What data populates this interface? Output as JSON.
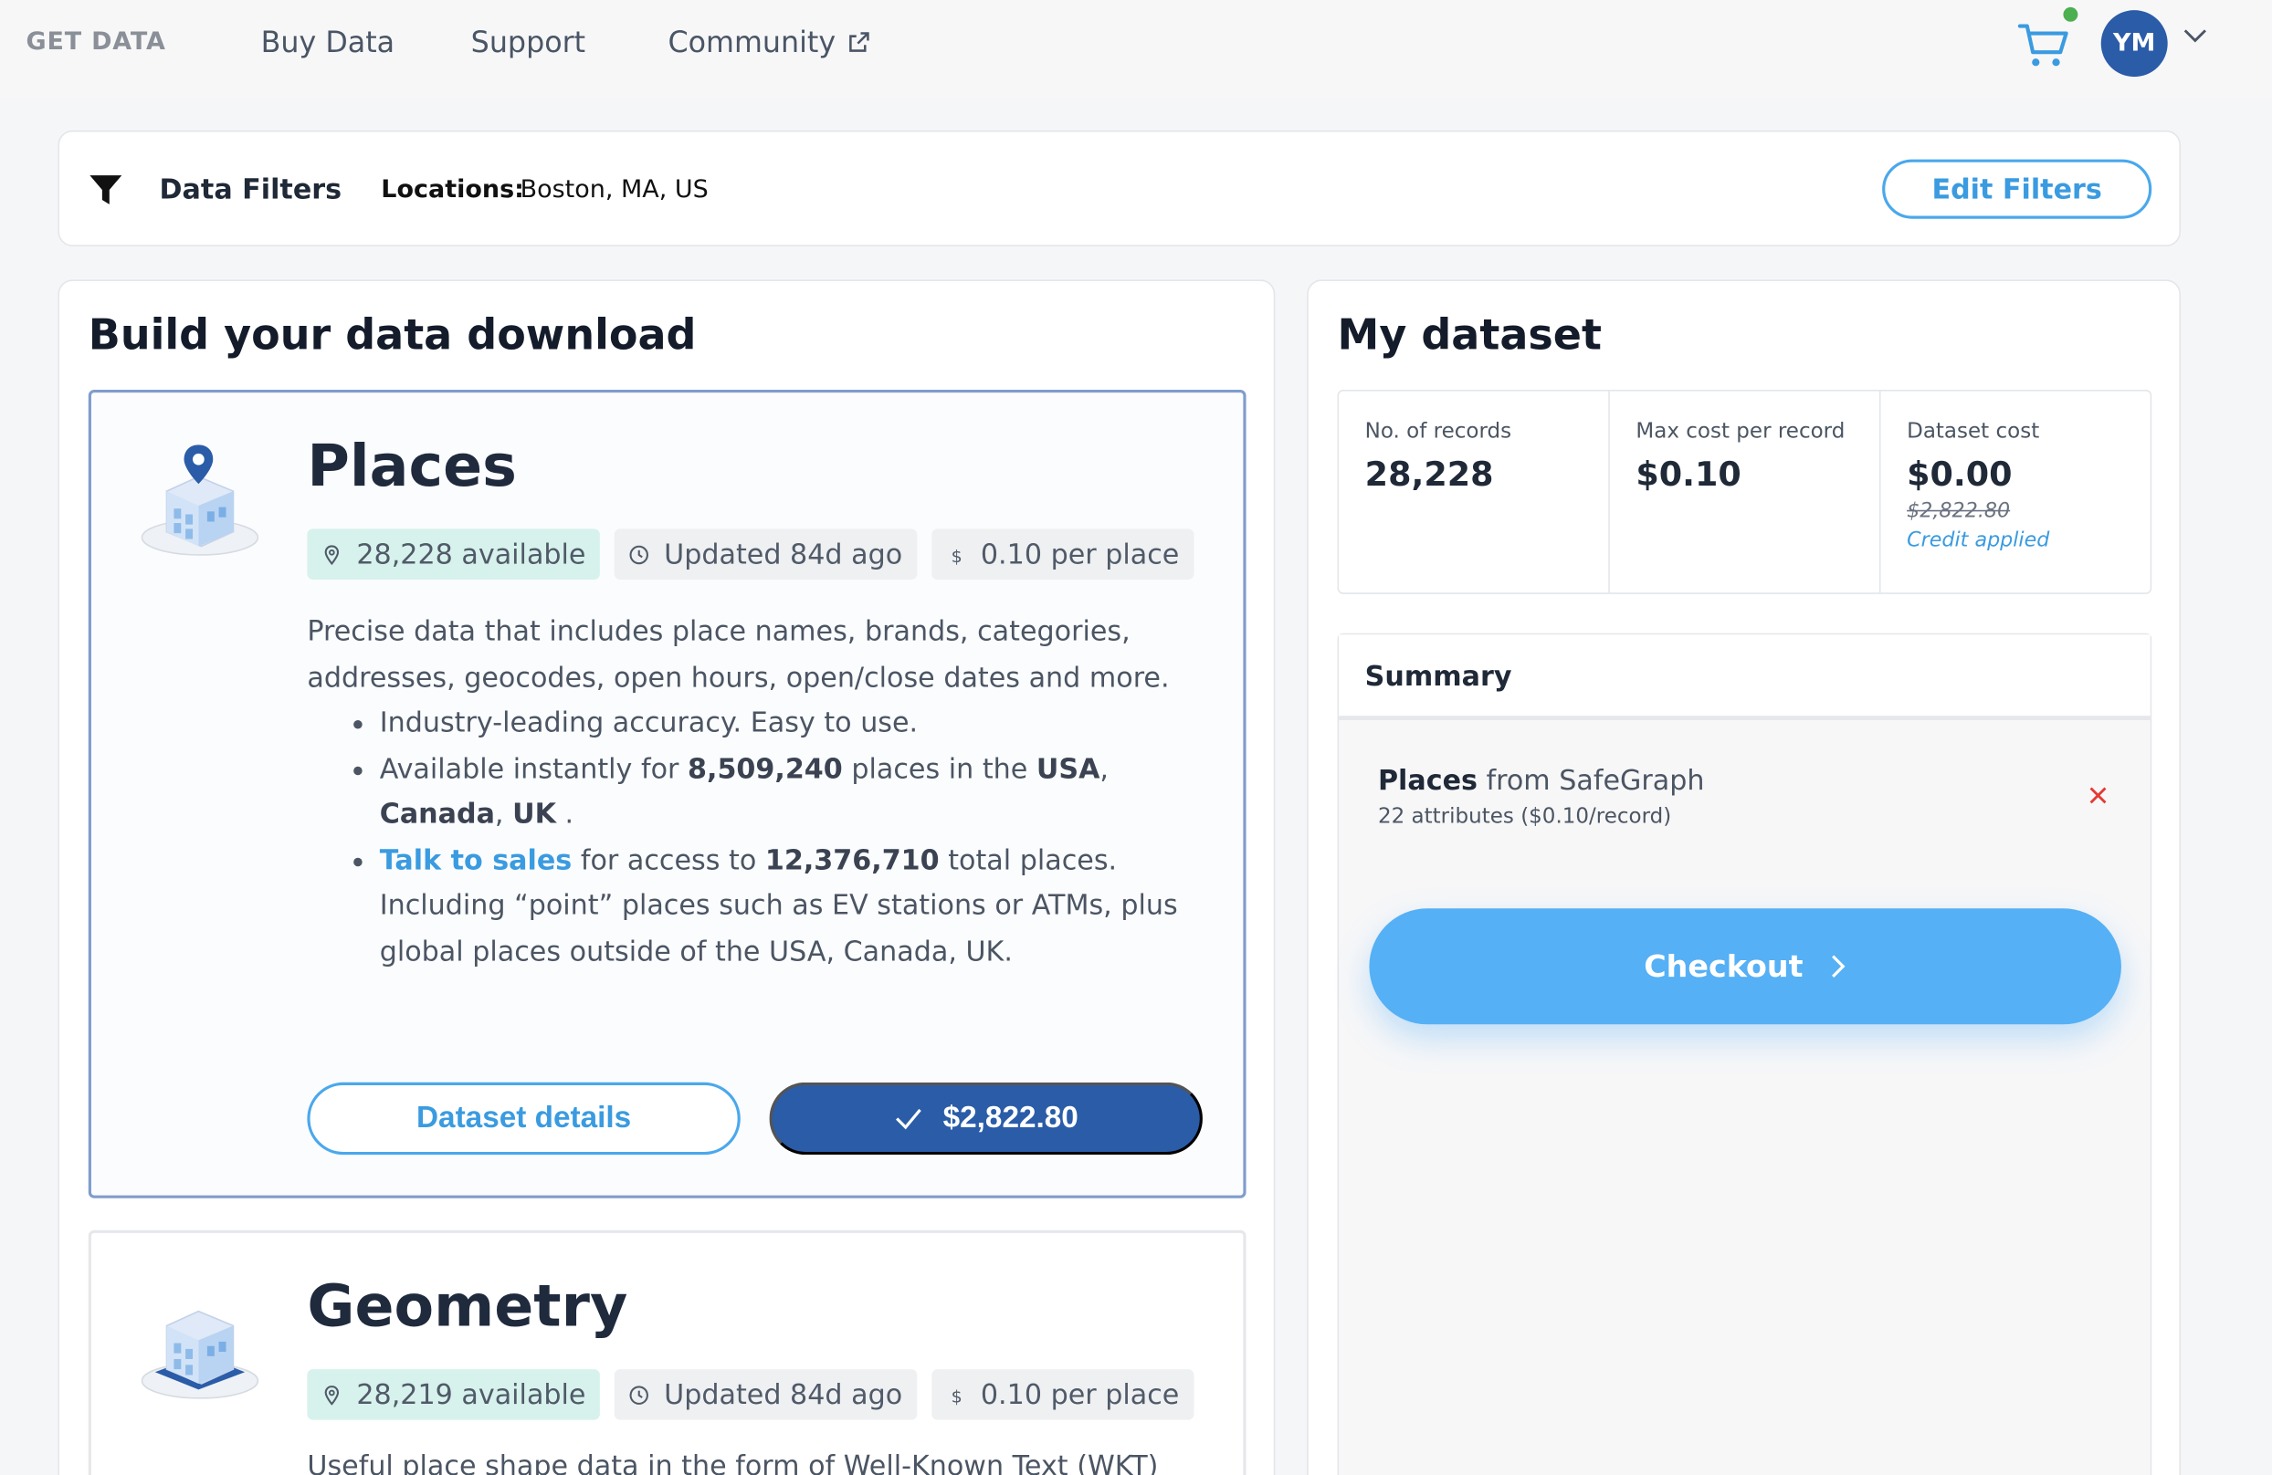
{
  "nav": {
    "brand": "GET DATA",
    "links": [
      "Buy Data",
      "Support",
      "Community"
    ],
    "avatar_initials": "YM",
    "notification_color": "#4caf50"
  },
  "filters": {
    "title": "Data Filters",
    "locations_label": "Locations:",
    "locations_value": "Boston, MA, US",
    "edit_label": "Edit Filters"
  },
  "build": {
    "title": "Build your data download",
    "places": {
      "title": "Places",
      "available": "28,228 available",
      "updated": "Updated 84d ago",
      "price": "0.10 per place",
      "description": "Precise data that includes place names, brands, categories, addresses, geocodes, open hours, open/close dates and more.",
      "bullet1": "Industry-leading accuracy. Easy to use.",
      "bullet2_pre": "Available instantly for ",
      "bullet2_count": "8,509,240",
      "bullet2_mid": " places in the ",
      "bullet2_usa": "USA",
      "bullet2_canada": "Canada",
      "bullet2_uk": "UK",
      "bullet3_link": "Talk to sales",
      "bullet3_pre": " for access to ",
      "bullet3_count": "12,376,710",
      "bullet3_post": " total places. Including “point” places such as EV stations or ATMs, plus global places outside of the USA, Canada, UK.",
      "details_button": "Dataset details",
      "price_button": "$2,822.80"
    },
    "geometry": {
      "title": "Geometry",
      "available": "28,219 available",
      "updated": "Updated 84d ago",
      "price": "0.10 per place",
      "description": "Useful place shape data in the form of Well-Known Text (WKT)"
    }
  },
  "dataset": {
    "title": "My dataset",
    "records_label": "No. of records",
    "records_value": "28,228",
    "max_cost_label": "Max cost per record",
    "max_cost_value": "$0.10",
    "cost_label": "Dataset cost",
    "cost_value": "$0.00",
    "cost_original": "$2,822.80",
    "credit_note": "Credit applied"
  },
  "summary": {
    "title": "Summary",
    "item_name": "Places",
    "item_source": "from SafeGraph",
    "item_attrs": "22 attributes ($0.10/record)",
    "checkout_label": "Checkout"
  },
  "colors": {
    "accent": "#3a9be0",
    "primary_dark": "#2a5ca8",
    "checkout": "#55b0f5",
    "remove": "#e53935"
  }
}
